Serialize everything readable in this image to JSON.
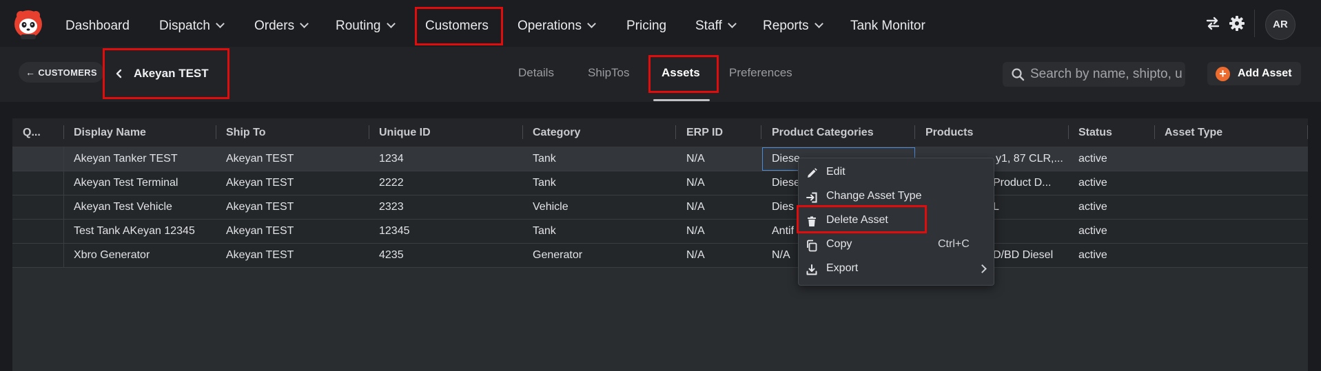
{
  "nav": {
    "items": [
      {
        "label": "Dashboard"
      },
      {
        "label": "Dispatch"
      },
      {
        "label": "Orders"
      },
      {
        "label": "Routing"
      },
      {
        "label": "Customers"
      },
      {
        "label": "Operations"
      },
      {
        "label": "Pricing"
      },
      {
        "label": "Staff"
      },
      {
        "label": "Reports"
      },
      {
        "label": "Tank Monitor"
      }
    ],
    "avatar_initials": "AR",
    "icons": [
      "logo-panda-icon",
      "swap-arrows-icon",
      "gear-icon"
    ]
  },
  "subheader": {
    "back_label": "CUSTOMERS",
    "customer_name": "Akeyan TEST",
    "tabs": [
      {
        "label": "Details"
      },
      {
        "label": "ShipTos"
      },
      {
        "label": "Assets"
      },
      {
        "label": "Preferences"
      }
    ],
    "active_tab": "Assets",
    "search_placeholder": "Search by name, shipto, u",
    "add_button_label": "Add Asset"
  },
  "grid": {
    "columns": [
      "Q...",
      "Display Name",
      "Ship To",
      "Unique ID",
      "Category",
      "ERP ID",
      "Product Categories",
      "Products",
      "Status",
      "Asset Type"
    ],
    "rows": [
      {
        "display_name": "Akeyan Tanker TEST",
        "ship_to": "Akeyan TEST",
        "unique_id": "1234",
        "category": "Tank",
        "erp_id": "N/A",
        "product_categories": "Diese",
        "products": "y1, 87 CLR,...",
        "status": "active"
      },
      {
        "display_name": "Akeyan Test Terminal",
        "ship_to": "Akeyan TEST",
        "unique_id": "2222",
        "category": "Tank",
        "erp_id": "N/A",
        "product_categories": "Diese",
        "products": "Product D...",
        "status": "active"
      },
      {
        "display_name": "Akeyan Test Vehicle",
        "ship_to": "Akeyan TEST",
        "unique_id": "2323",
        "category": "Vehicle",
        "erp_id": "N/A",
        "product_categories": "Dies",
        "products": "L",
        "status": "active"
      },
      {
        "display_name": "Test Tank AKeyan 12345",
        "ship_to": "Akeyan TEST",
        "unique_id": "12345",
        "category": "Tank",
        "erp_id": "N/A",
        "product_categories": "Antif",
        "products": "",
        "status": "active"
      },
      {
        "display_name": "Xbro Generator",
        "ship_to": "Akeyan TEST",
        "unique_id": "4235",
        "category": "Generator",
        "erp_id": "N/A",
        "product_categories": "N/A",
        "products": "D/BD Diesel",
        "status": "active"
      }
    ]
  },
  "context_menu": {
    "items": [
      {
        "label": "Edit",
        "icon": "pencil-icon"
      },
      {
        "label": "Change Asset Type",
        "icon": "arrow-into-box-icon"
      },
      {
        "label": "Delete Asset",
        "icon": "trash-icon"
      },
      {
        "label": "Copy",
        "icon": "copy-icon",
        "shortcut": "Ctrl+C"
      },
      {
        "label": "Export",
        "icon": "download-icon",
        "has_submenu": true
      }
    ]
  },
  "colors": {
    "highlight_box": "#e10d0d",
    "accent_orange": "#ec6c2f",
    "focus_border": "#4c8bd8"
  }
}
